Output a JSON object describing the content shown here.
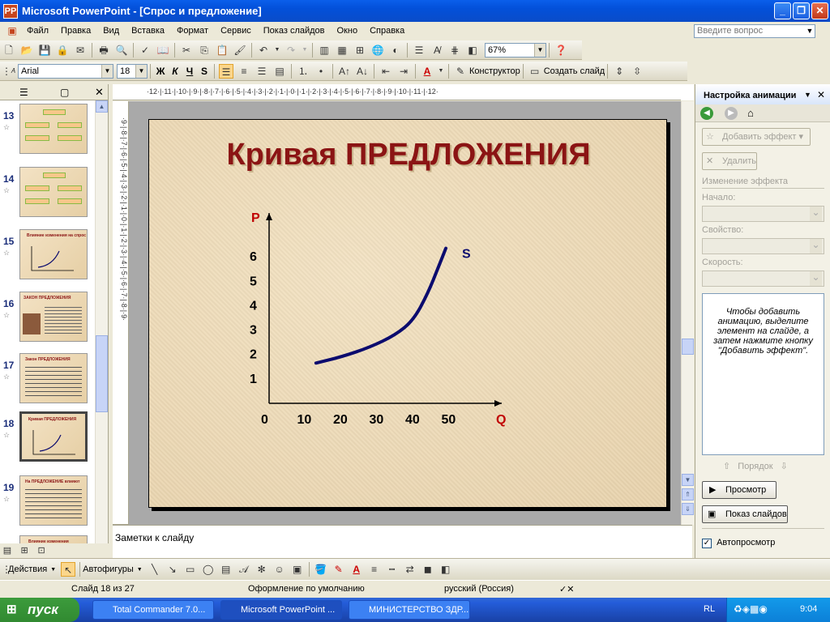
{
  "window": {
    "title": "Microsoft PowerPoint - [Спрос и предложение]",
    "app_icon": "PP"
  },
  "menu": [
    "Файл",
    "Правка",
    "Вид",
    "Вставка",
    "Формат",
    "Сервис",
    "Показ слайдов",
    "Окно",
    "Справка"
  ],
  "help_box": {
    "placeholder": "Введите вопрос"
  },
  "toolbar": {
    "zoom": "67%",
    "font": "Arial",
    "size": "18",
    "bold": "Ж",
    "italic": "К",
    "underline": "Ч",
    "shadow": "S",
    "designer": "Конструктор",
    "new_slide": "Создать слайд"
  },
  "thumbnails": [
    {
      "num": "13",
      "title": "",
      "type": "diagram"
    },
    {
      "num": "14",
      "title": "",
      "type": "diagram"
    },
    {
      "num": "15",
      "title": "Влияние изменения на спрос",
      "type": "chart"
    },
    {
      "num": "16",
      "title": "ЗАКОН ПРЕДЛОЖЕНИЯ",
      "type": "text-image"
    },
    {
      "num": "17",
      "title": "Закон ПРЕДЛОЖЕНИЯ",
      "type": "text"
    },
    {
      "num": "18",
      "title": "Кривая ПРЕДЛОЖЕНИЯ",
      "type": "chart"
    },
    {
      "num": "19",
      "title": "На ПРЕДЛОЖЕНИЕ влияют",
      "type": "list"
    },
    {
      "num": "20",
      "title": "Влияние изменения",
      "type": "partial"
    }
  ],
  "slide": {
    "title": "Кривая ПРЕДЛОЖЕНИЯ"
  },
  "chart_data": {
    "type": "line",
    "title": "Кривая ПРЕДЛОЖЕНИЯ",
    "xlabel": "Q",
    "ylabel": "P",
    "x_ticks": [
      "0",
      "10",
      "20",
      "30",
      "40",
      "50"
    ],
    "y_ticks": [
      "1",
      "2",
      "3",
      "4",
      "5",
      "6"
    ],
    "xlim": [
      0,
      60
    ],
    "ylim": [
      0,
      6.8
    ],
    "series": [
      {
        "name": "S",
        "color": "#0B0B6E",
        "points": [
          [
            13,
            1.65
          ],
          [
            20,
            1.9
          ],
          [
            28,
            2.3
          ],
          [
            35,
            2.8
          ],
          [
            40,
            3.4
          ],
          [
            44,
            4.5
          ],
          [
            47,
            5.6
          ],
          [
            49,
            6.35
          ]
        ]
      }
    ]
  },
  "notes": "Заметки к слайду",
  "taskpane": {
    "title": "Настройка анимации",
    "add_effect": "Добавить эффект",
    "delete": "Удалить",
    "section": "Изменение эффекта",
    "start": "Начало:",
    "property": "Свойство:",
    "speed": "Скорость:",
    "hint": "Чтобы добавить анимацию, выделите элемент на слайде, а затем нажмите кнопку \"Добавить эффект\".",
    "order": "Порядок",
    "preview": "Просмотр",
    "slideshow": "Показ слайдов",
    "autopreview": "Автопросмотр"
  },
  "drawbar": {
    "actions": "Действия",
    "autoshapes": "Автофигуры"
  },
  "status": {
    "slide": "Слайд 18 из 27",
    "design": "Оформление по умолчанию",
    "lang": "русский (Россия)"
  },
  "taskbar": {
    "start": "пуск",
    "tasks": [
      "Total Commander 7.0...",
      "Microsoft PowerPoint ...",
      "МИНИСТЕРСТВО ЗДР..."
    ],
    "lang": "RL",
    "clock": "9:04"
  }
}
